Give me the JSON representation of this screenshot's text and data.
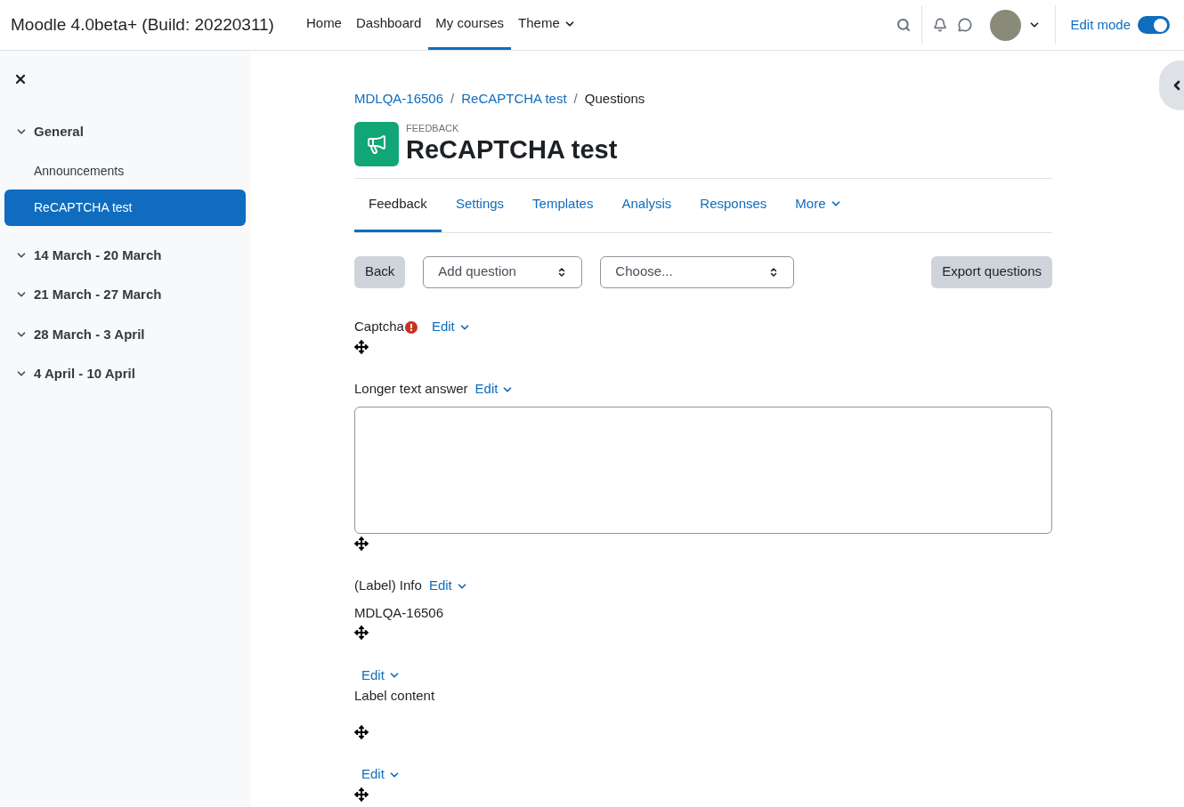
{
  "navbar": {
    "site_name": "Moodle 4.0beta+ (Build: 20220311)",
    "links": [
      {
        "label": "Home",
        "selected": false,
        "dropdown": false
      },
      {
        "label": "Dashboard",
        "selected": false,
        "dropdown": false
      },
      {
        "label": "My courses",
        "selected": true,
        "dropdown": false
      },
      {
        "label": "Theme",
        "selected": false,
        "dropdown": true
      }
    ],
    "edit_mode": {
      "label": "Edit mode",
      "on": true
    }
  },
  "course_index": {
    "sections": [
      {
        "title": "General",
        "children": [
          {
            "label": "Announcements",
            "selected": false
          },
          {
            "label": "ReCAPTCHA test",
            "selected": true
          }
        ]
      },
      {
        "title": "14 March - 20 March"
      },
      {
        "title": "21 March - 27 March"
      },
      {
        "title": "28 March - 3 April"
      },
      {
        "title": "4 April - 10 April"
      }
    ]
  },
  "breadcrumb_separator": "/",
  "breadcrumb": [
    {
      "label": "MDLQA-16506",
      "link": true
    },
    {
      "label": "ReCAPTCHA test",
      "link": true
    },
    {
      "label": "Questions",
      "link": false
    }
  ],
  "header": {
    "module_type": "FEEDBACK",
    "title": "ReCAPTCHA test"
  },
  "tabs": [
    {
      "label": "Feedback",
      "selected": true,
      "dropdown": false
    },
    {
      "label": "Settings",
      "selected": false,
      "dropdown": false
    },
    {
      "label": "Templates",
      "selected": false,
      "dropdown": false
    },
    {
      "label": "Analysis",
      "selected": false,
      "dropdown": false
    },
    {
      "label": "Responses",
      "selected": false,
      "dropdown": false
    },
    {
      "label": "More",
      "selected": false,
      "dropdown": true
    }
  ],
  "toolbar": {
    "back": "Back",
    "add_question": "Add question",
    "template": "Choose...",
    "export": "Export questions"
  },
  "items": [
    {
      "kind": "field",
      "label": "Captcha",
      "required": true,
      "edit": "Edit"
    },
    {
      "kind": "textarea",
      "label": "Longer text answer",
      "required": false,
      "edit": "Edit"
    },
    {
      "kind": "label",
      "label": "(Label) Info",
      "required": false,
      "edit": "Edit",
      "content": "MDLQA-16506"
    },
    {
      "kind": "label",
      "required": false,
      "edit": "Edit",
      "content": "Label content"
    },
    {
      "kind": "field",
      "required": false,
      "edit": "Edit"
    }
  ]
}
